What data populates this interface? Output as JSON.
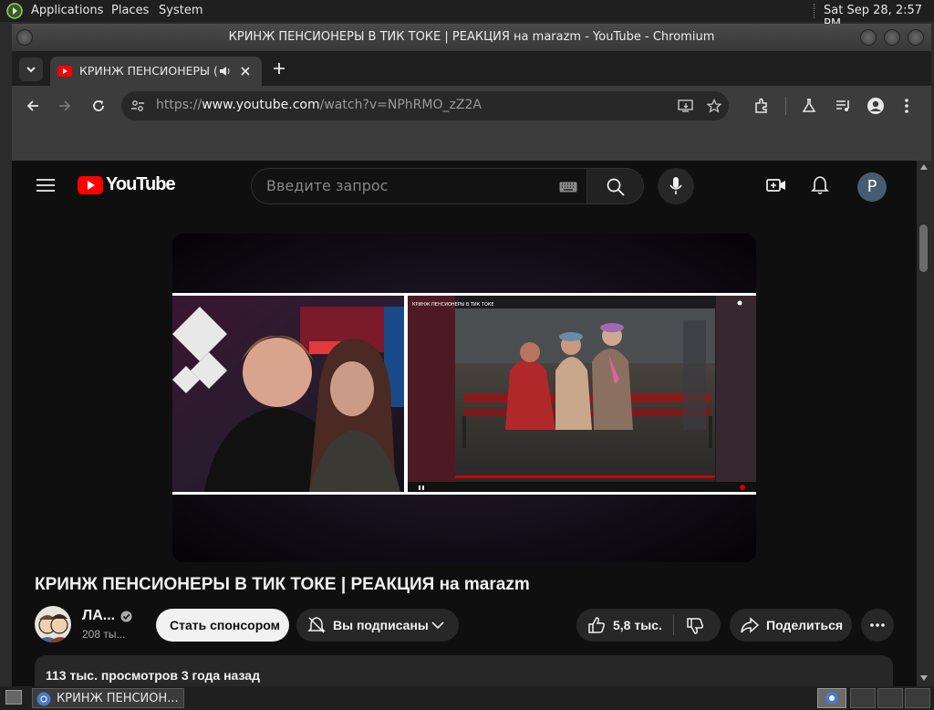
{
  "top_panel": {
    "menus": [
      "Applications",
      "Places",
      "System"
    ],
    "clock": "Sat Sep 28,  2:57 PM"
  },
  "window": {
    "title": "КРИНЖ ПЕНСИОНЕРЫ В ТИК ТОКЕ | РЕАКЦИЯ на marazm - YouTube - Chromium"
  },
  "tab": {
    "title": "КРИНЖ ПЕНСИОНЕРЫ ("
  },
  "omnibox": {
    "scheme": "https://",
    "host": "www.youtube.com",
    "path": "/watch?v=NPhRMO_zZ2A"
  },
  "youtube": {
    "logo_text": "YouTube",
    "search_placeholder": "Введите запрос",
    "avatar_letter": "P",
    "video_title": "КРИНЖ ПЕНСИОНЕРЫ В ТИК ТОКЕ | РЕАКЦИЯ на marazm",
    "channel_name": "ЛА...",
    "subscribers": "208 ты...",
    "sponsor_label": "Стать спонсором",
    "subscribed_label": "Вы подписаны",
    "likes": "5,8 тыс.",
    "share_label": "Поделиться",
    "description_meta": "113 тыс. просмотров  3 года назад",
    "inner_video_title": "КРИНЖ ПЕНСИОНЕРЫ В ТИК ТОКЕ"
  },
  "taskbar": {
    "task_label": "КРИНЖ ПЕНСИОН..."
  },
  "colors": {
    "youtube_red": "#ff0000",
    "page_bg": "#0f0f0f",
    "avatar_bg": "#465c70"
  }
}
